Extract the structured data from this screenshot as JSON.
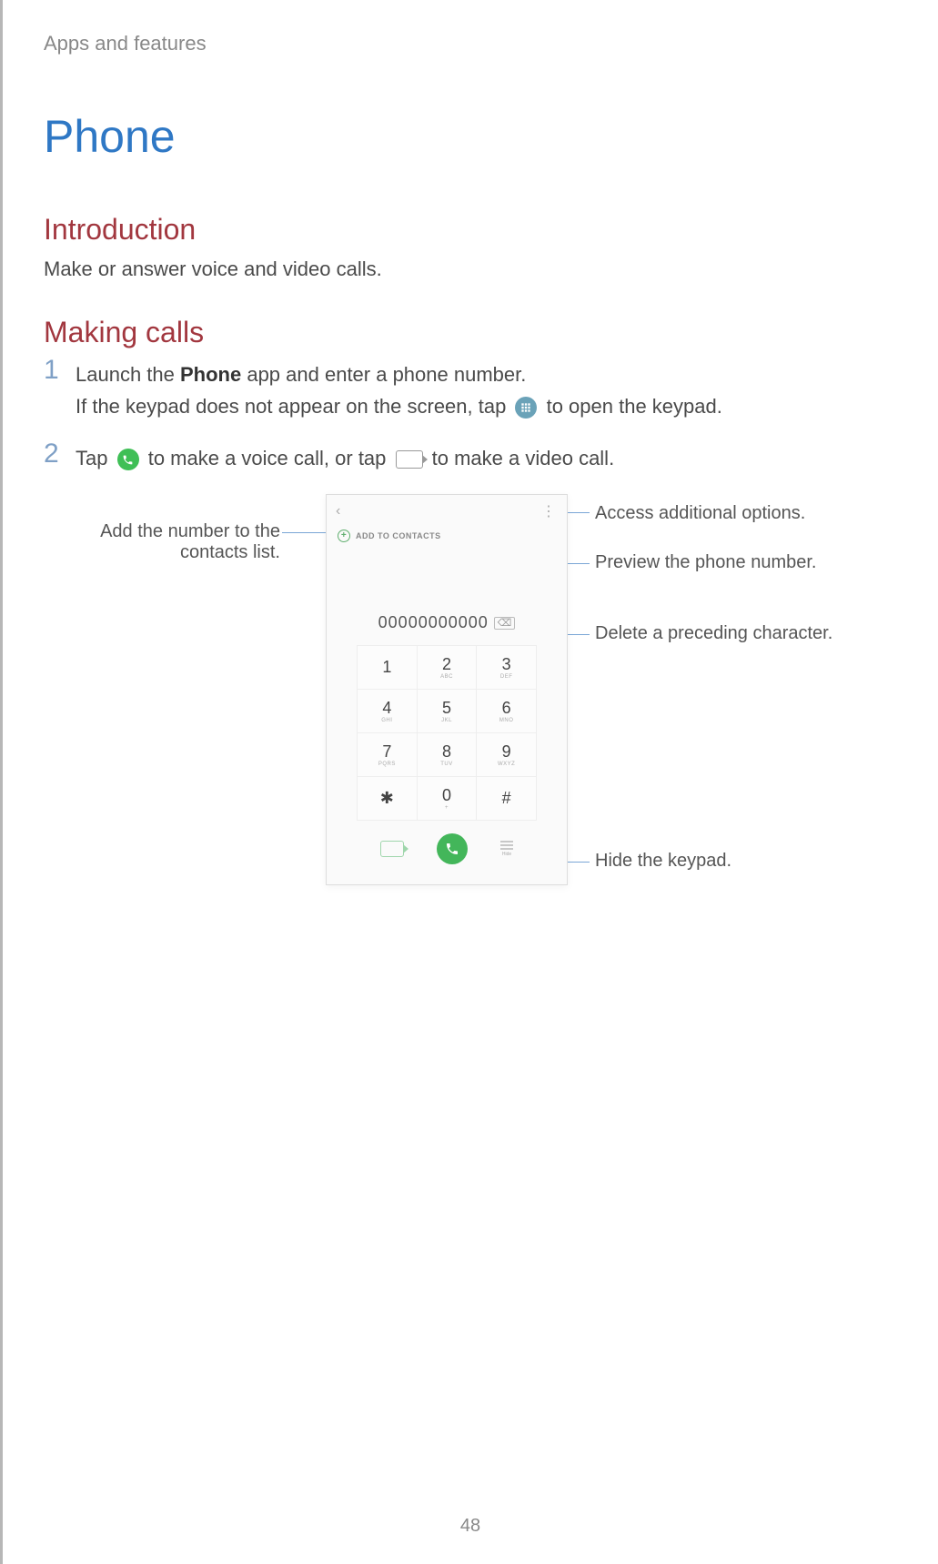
{
  "breadcrumb": "Apps and features",
  "title": "Phone",
  "section_intro": "Introduction",
  "intro_text": "Make or answer voice and video calls.",
  "section_making": "Making calls",
  "steps": {
    "s1": {
      "num": "1",
      "line1a": "Launch the ",
      "line1_bold": "Phone",
      "line1b": " app and enter a phone number.",
      "line2a": "If the keypad does not appear on the screen, tap ",
      "line2b": " to open the keypad."
    },
    "s2": {
      "num": "2",
      "a": "Tap ",
      "b": " to make a voice call, or tap ",
      "c": " to make a video call."
    }
  },
  "screenshot": {
    "back": "‹",
    "more": "⋮",
    "add_to_contacts": "ADD TO CONTACTS",
    "number": "00000000000",
    "del": "⌫",
    "keys": [
      {
        "d": "1",
        "l": "   "
      },
      {
        "d": "2",
        "l": "ABC"
      },
      {
        "d": "3",
        "l": "DEF"
      },
      {
        "d": "4",
        "l": "GHI"
      },
      {
        "d": "5",
        "l": "JKL"
      },
      {
        "d": "6",
        "l": "MNO"
      },
      {
        "d": "7",
        "l": "PQRS"
      },
      {
        "d": "8",
        "l": "TUV"
      },
      {
        "d": "9",
        "l": "WXYZ"
      },
      {
        "d": "✱",
        "l": ""
      },
      {
        "d": "0",
        "l": "+"
      },
      {
        "d": "#",
        "l": ""
      }
    ],
    "hide_label": "Hide"
  },
  "callouts": {
    "add_contacts": "Add the number to the\ncontacts list.",
    "options": "Access additional options.",
    "preview": "Preview the phone number.",
    "delete": "Delete a preceding character.",
    "hide": "Hide the keypad."
  },
  "page_number": "48"
}
